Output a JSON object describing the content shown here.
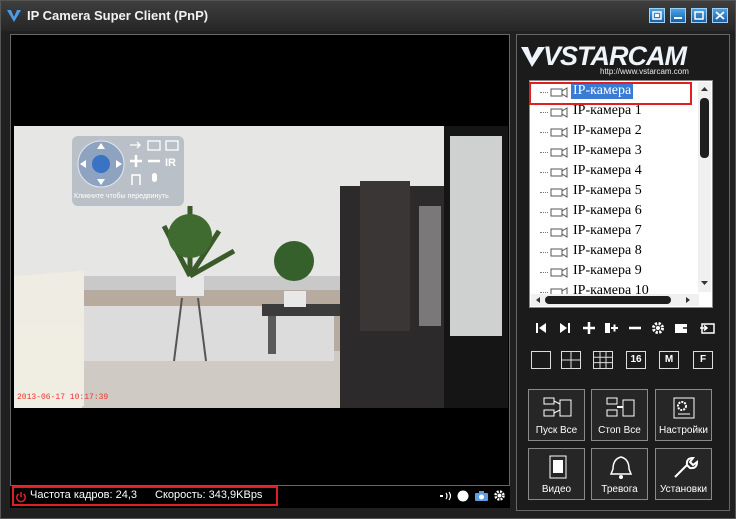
{
  "window": {
    "title": "IP Camera Super Client (PnP)"
  },
  "video": {
    "timestamp": "2013-06-17 10:17:39",
    "ptz_hint": "Кликните чтобы передвинуть"
  },
  "status": {
    "fps_label": "Частота кадров: 24,3",
    "speed_label": "Скорость: 343,9KBps"
  },
  "brand": {
    "logo": "VSTARCAM",
    "url": "http://www.vstarcam.com"
  },
  "cameras": [
    "IP-камера",
    "IP-камера 1",
    "IP-камера 2",
    "IP-камера 3",
    "IP-камера 4",
    "IP-камера 5",
    "IP-камера 6",
    "IP-камера 7",
    "IP-камера 8",
    "IP-камера 9",
    "IP-камера 10"
  ],
  "layouts": {
    "sixteen": "16",
    "m": "M",
    "f": "F"
  },
  "buttons": {
    "start_all": "Пуск Все",
    "stop_all": "Стоп Все",
    "settings": "Настройки",
    "video": "Видео",
    "alarm": "Тревога",
    "setup": "Установки"
  },
  "colors": {
    "accent_red": "#e02020",
    "selection": "#3a7bd5",
    "titlebar_button": "#2a7fd0"
  }
}
